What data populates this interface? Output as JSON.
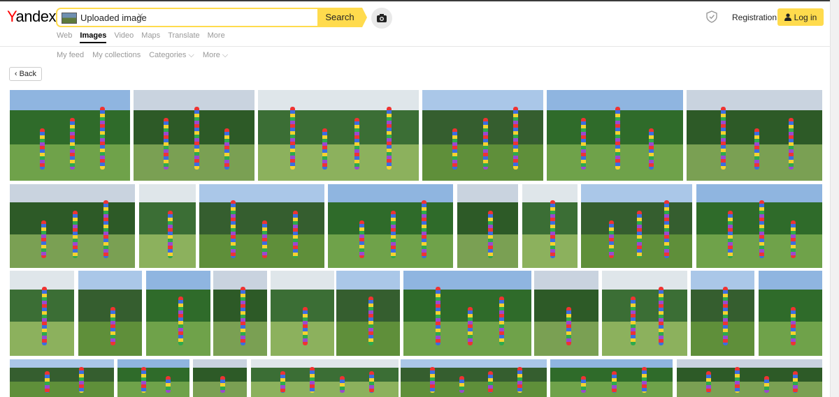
{
  "logo": {
    "first": "Y",
    "rest": "andex"
  },
  "search": {
    "query": "Uploaded image",
    "button": "Search"
  },
  "header": {
    "registration": "Registration",
    "login": "Log in"
  },
  "tabs": [
    "Web",
    "Images",
    "Video",
    "Maps",
    "Translate",
    "More"
  ],
  "subnav": [
    "My feed",
    "My collections",
    "Categories ⌵",
    "More ⌵"
  ],
  "back": "Back",
  "colors": {
    "accent": "#ffdb4d",
    "logo_red": "#ff0000"
  },
  "results": {
    "rows": [
      {
        "tiles": 6
      },
      {
        "tiles": 8
      },
      {
        "tiles": 11
      },
      {
        "tiles": 8
      }
    ]
  }
}
